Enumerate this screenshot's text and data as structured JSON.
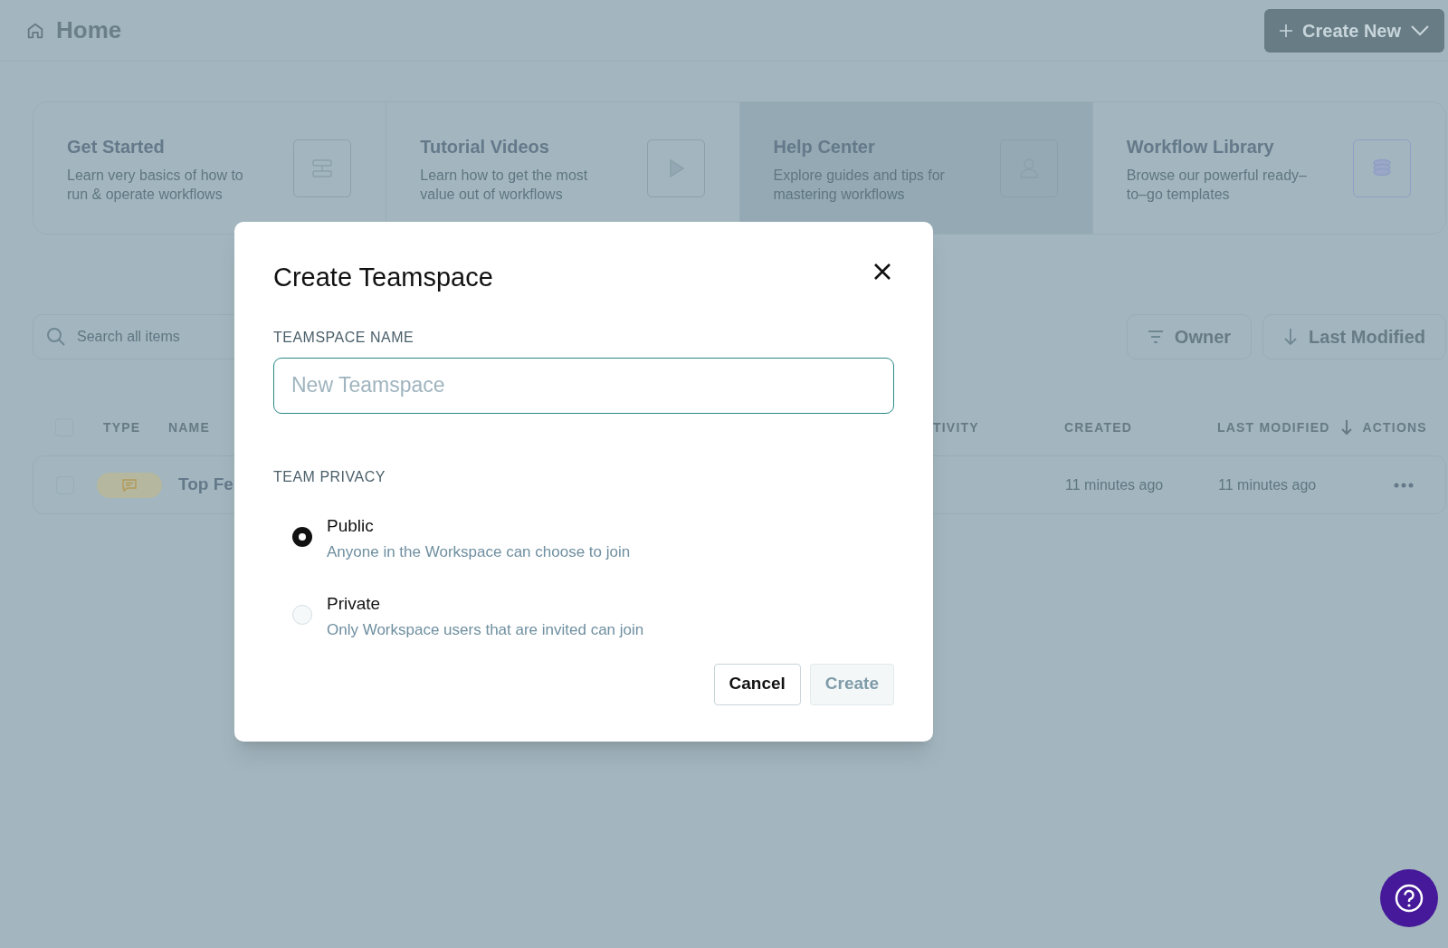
{
  "header": {
    "title": "Home",
    "create_button": "Create New"
  },
  "cards": [
    {
      "title": "Get Started",
      "description": "Learn very basics of how to run & operate workflows",
      "highlighted": false
    },
    {
      "title": "Tutorial Videos",
      "description": "Learn how to get the most value out of workflows",
      "highlighted": false
    },
    {
      "title": "Help Center",
      "description": "Explore guides and tips for mastering workflows",
      "highlighted": true
    },
    {
      "title": "Workflow Library",
      "description": "Browse our powerful ready–to–go templates",
      "highlighted": false
    }
  ],
  "search": {
    "placeholder": "Search all items"
  },
  "filters": [
    {
      "label": "Owner"
    },
    {
      "label": "Last Modified"
    }
  ],
  "table": {
    "all_checked": false,
    "columns": [
      "TYPE",
      "NAME",
      "TIVITY",
      "CREATED",
      "LAST MODIFIED",
      "ACTIONS"
    ],
    "rows": [
      {
        "name": "Top Fe",
        "created": "11 minutes ago",
        "last_modified": "11 minutes ago",
        "checked": false
      }
    ]
  },
  "dialog": {
    "title": "Create Teamspace",
    "name_label": "TEAMSPACE NAME",
    "name_field": {
      "placeholder": "New Teamspace"
    },
    "privacy_label": "TEAM PRIVACY",
    "options": [
      {
        "label": "Public",
        "description": "Anyone in the Workspace can choose to join",
        "selected": true
      },
      {
        "label": "Private",
        "description": "Only Workspace users that are invited can join",
        "selected": false
      }
    ],
    "buttons": [
      {
        "label": "Cancel",
        "disabled": false
      },
      {
        "label": "Create",
        "disabled": true
      }
    ]
  }
}
